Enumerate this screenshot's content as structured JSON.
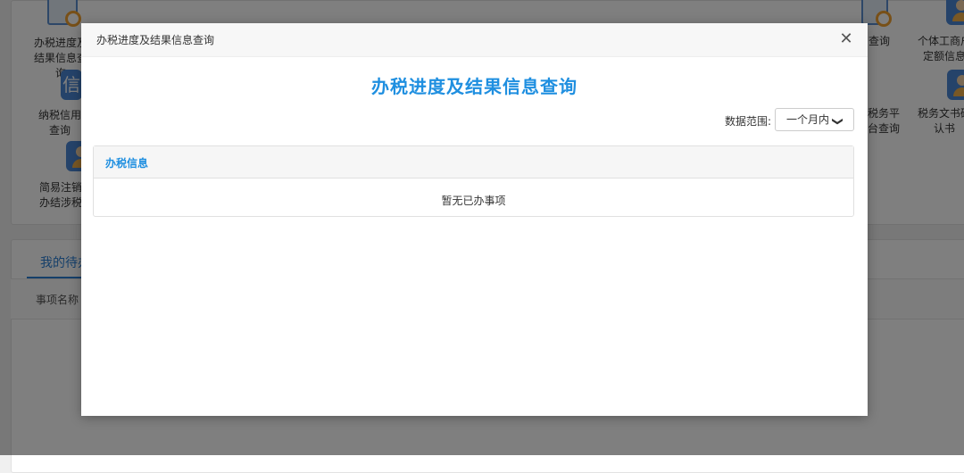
{
  "background": {
    "tiles": [
      {
        "label": "办税进度及结果信息查询",
        "icon": "person-search-icon"
      },
      {
        "label": "纳税信用查询",
        "icon": "credit-badge-icon"
      },
      {
        "label": "简易注销办结涉税",
        "icon": "person-icon"
      },
      {
        "label": "查询",
        "icon": "document-search-icon"
      },
      {
        "label": "个体工商户定额信息",
        "icon": "person-icon"
      },
      {
        "label": "税务平台查询",
        "icon": "document-icon"
      },
      {
        "label": "税务文书确认书",
        "icon": "person-icon"
      }
    ],
    "tabs": {
      "pending": "我的待办"
    },
    "table": {
      "col_name": "事项名称"
    }
  },
  "modal": {
    "window_title": "办税进度及结果信息查询",
    "heading": "办税进度及结果信息查询",
    "range_label": "数据范围:",
    "range_value": "一个月内",
    "panel_title": "办税信息",
    "empty_text": "暂无已办事项",
    "accent_color": "#1f8fe0"
  }
}
